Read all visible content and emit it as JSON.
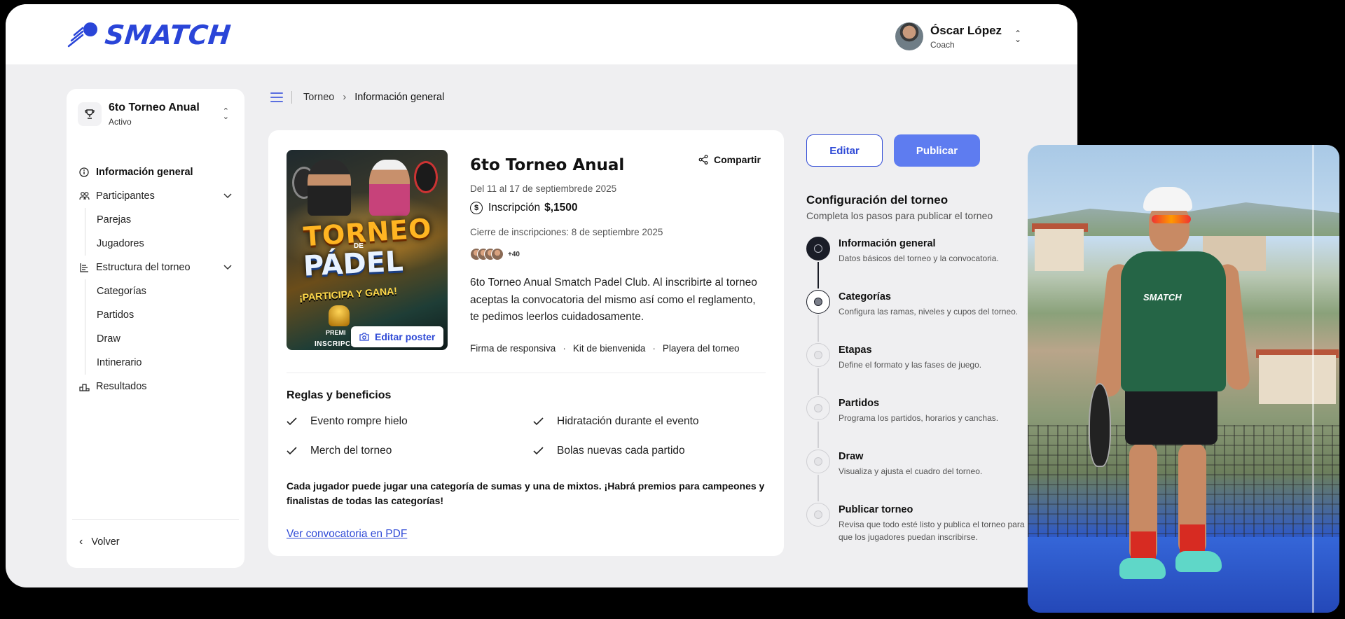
{
  "brand": {
    "name": "SMATCH",
    "color": "#2a45d8"
  },
  "user": {
    "name": "Óscar López",
    "role": "Coach"
  },
  "sidebar": {
    "tournament": {
      "name": "6to Torneo Anual",
      "status": "Activo"
    },
    "items": [
      {
        "label": "Información general",
        "icon": "info-icon",
        "active": true
      },
      {
        "label": "Participantes",
        "icon": "people-icon",
        "sub": [
          "Parejas",
          "Jugadores"
        ]
      },
      {
        "label": "Estructura del torneo",
        "icon": "structure-icon",
        "sub": [
          "Categorías",
          "Partidos",
          "Draw",
          "Intinerario"
        ]
      },
      {
        "label": "Resultados",
        "icon": "podium-icon"
      }
    ],
    "back_label": "Volver"
  },
  "breadcrumb": {
    "root": "Torneo",
    "current": "Información general"
  },
  "poster": {
    "line1": "TORNEO",
    "line_de": "DE",
    "line2": "PÁDEL",
    "line3": "¡PARTICIPA Y GANA!",
    "line4": "PREMI",
    "line5": "INSCRIPCIONES ABIERTAS",
    "edit_label": "Editar poster"
  },
  "tournament": {
    "title": "6to Torneo Anual",
    "share_label": "Compartir",
    "dates": "Del 11 al 17 de septiembrede 2025",
    "fee_label": "Inscripción",
    "fee_value": "$,1500",
    "registration_close": "Cierre de inscripciones: 8 de septiembre 2025",
    "avatars_more": "+40",
    "description": "6to Torneo Anual Smatch Padel Club. Al inscribirte al torneo aceptas la convocatoria del mismo así como el reglamento, te pedimos leerlos cuidadosamente.",
    "perks": [
      "Firma de responsiva",
      "Kit de bienvenida",
      "Playera del torneo"
    ]
  },
  "rules": {
    "title": "Reglas y beneficios",
    "items": [
      "Evento rompre hielo",
      "Hidratación durante el evento",
      "Merch del torneo",
      "Bolas nuevas cada partido"
    ],
    "note": "Cada jugador puede jugar una categoría de sumas y una de mixtos. ¡Habrá premios para campeones y finalistas de todas las categorías!",
    "pdf_link": "Ver convocatoria en PDF"
  },
  "actions": {
    "edit": "Editar",
    "publish": "Publicar",
    "publish_color": "#5e7cf0"
  },
  "config": {
    "title": "Configuración del torneo",
    "subtitle": "Completa los pasos para publicar el torneo",
    "steps": [
      {
        "title": "Información general",
        "desc": "Datos básicos del torneo y la convocatoria.",
        "state": "done"
      },
      {
        "title": "Categorías",
        "desc": "Configura las ramas, niveles y cupos del torneo.",
        "state": "current"
      },
      {
        "title": "Etapas",
        "desc": "Define el formato y las fases de juego.",
        "state": "pending"
      },
      {
        "title": "Partidos",
        "desc": "Programa los partidos, horarios y canchas.",
        "state": "pending"
      },
      {
        "title": "Draw",
        "desc": "Visualiza y ajusta el cuadro del torneo.",
        "state": "pending"
      },
      {
        "title": "Publicar torneo",
        "desc": "Revisa que todo esté listo y publica el torneo para que los jugadores puedan inscribirse.",
        "state": "pending"
      }
    ]
  },
  "photo": {
    "shirt_brand": "SMATCH"
  }
}
